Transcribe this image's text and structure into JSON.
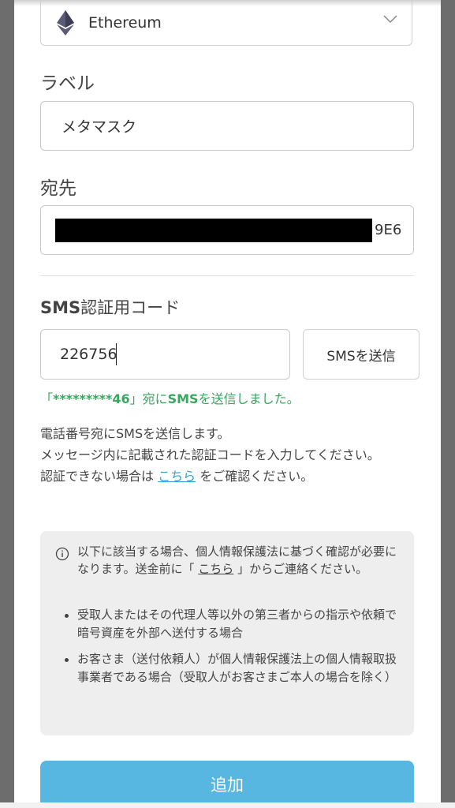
{
  "network_select": {
    "value": "Ethereum",
    "icon": "ethereum-icon"
  },
  "label_field": {
    "title": "ラベル",
    "value": "メタマスク"
  },
  "address_field": {
    "title": "宛先",
    "value_tail": "9E6"
  },
  "sms": {
    "title_bold": "SMS",
    "title_rest": "認証用コード",
    "code_value": "226756",
    "send_button": "SMSを送信",
    "sent_prefix": "「",
    "sent_number": "*********46",
    "sent_mid": "」宛に",
    "sent_sms": "SMS",
    "sent_suffix": "を送信しました。"
  },
  "info": {
    "line1": "電話番号宛にSMSを送信します。",
    "line2": "メッセージ内に記載された認証コードを入力してください。",
    "line3_prefix": "認証できない場合は",
    "line3_link": "こちら",
    "line3_suffix": "をご確認ください。"
  },
  "notice": {
    "intro_prefix": "以下に該当する場合、個人情報保護法に基づく確認が必要になります。送金前に「",
    "intro_link": "こちら",
    "intro_suffix": "」からご連絡ください。",
    "bullets": [
      "受取人またはその代理人等以外の第三者からの指示や依頼で暗号資産を外部へ送付する場合",
      "お客さま（送付依頼人）が個人情報保護法上の個人情報取扱事業者である場合（受取人がお客さまご本人の場合を除く）"
    ]
  },
  "add_button": "追加",
  "colors": {
    "accent": "#58b7e0",
    "success": "#3aa55f",
    "link": "#2ea5d6"
  }
}
